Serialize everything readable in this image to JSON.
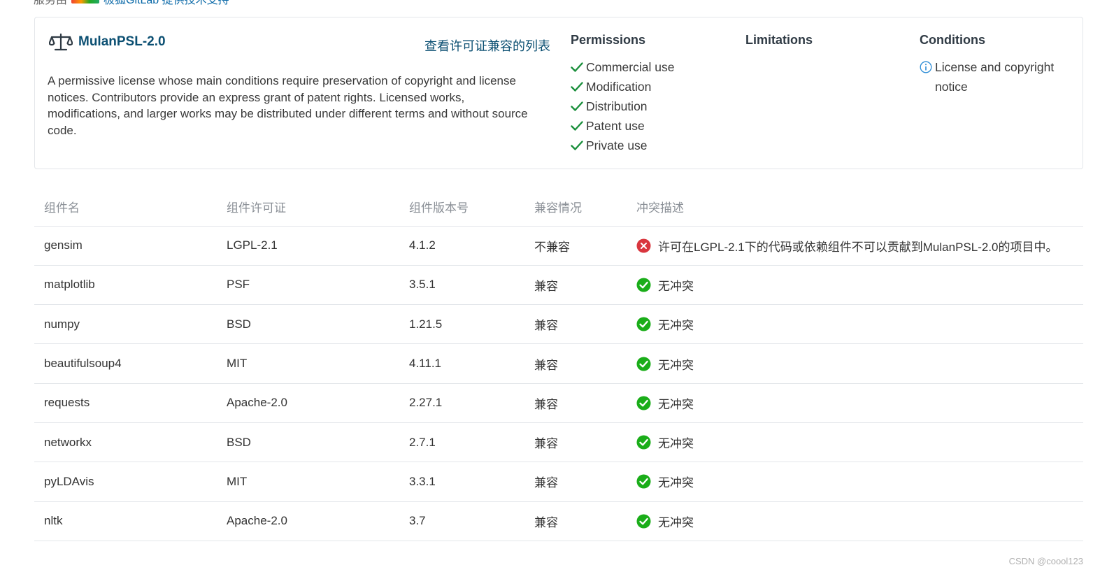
{
  "top_partial": {
    "text_left": "服务由",
    "link": "极狐GitLab 提供技术支持"
  },
  "license": {
    "name": "MulanPSL-2.0",
    "compat_link": "查看许可证兼容的列表",
    "description": "A permissive license whose main conditions require preservation of copyright and license notices. Contributors provide an express grant of patent rights. Licensed works, modifications, and larger works may be distributed under different terms and without source code.",
    "permissions": {
      "title": "Permissions",
      "items": [
        "Commercial use",
        "Modification",
        "Distribution",
        "Patent use",
        "Private use"
      ]
    },
    "limitations": {
      "title": "Limitations",
      "items": []
    },
    "conditions": {
      "title": "Conditions",
      "items": [
        "License and copyright notice"
      ]
    }
  },
  "table": {
    "headers": [
      "组件名",
      "组件许可证",
      "组件版本号",
      "兼容情况",
      "冲突描述"
    ],
    "rows": [
      {
        "name": "gensim",
        "license": "LGPL-2.1",
        "version": "4.1.2",
        "compat": "不兼容",
        "status": "error",
        "desc": "许可在LGPL-2.1下的代码或依赖组件不可以贡献到MulanPSL-2.0的项目中。"
      },
      {
        "name": "matplotlib",
        "license": "PSF",
        "version": "3.5.1",
        "compat": "兼容",
        "status": "ok",
        "desc": "无冲突"
      },
      {
        "name": "numpy",
        "license": "BSD",
        "version": "1.21.5",
        "compat": "兼容",
        "status": "ok",
        "desc": "无冲突"
      },
      {
        "name": "beautifulsoup4",
        "license": "MIT",
        "version": "4.11.1",
        "compat": "兼容",
        "status": "ok",
        "desc": "无冲突"
      },
      {
        "name": "requests",
        "license": "Apache-2.0",
        "version": "2.27.1",
        "compat": "兼容",
        "status": "ok",
        "desc": "无冲突"
      },
      {
        "name": "networkx",
        "license": "BSD",
        "version": "2.7.1",
        "compat": "兼容",
        "status": "ok",
        "desc": "无冲突"
      },
      {
        "name": "pyLDAvis",
        "license": "MIT",
        "version": "3.3.1",
        "compat": "兼容",
        "status": "ok",
        "desc": "无冲突"
      },
      {
        "name": "nltk",
        "license": "Apache-2.0",
        "version": "3.7",
        "compat": "兼容",
        "status": "ok",
        "desc": "无冲突"
      }
    ]
  },
  "watermark": "CSDN @coool123",
  "colors": {
    "link": "#0b4f72",
    "check": "#1a8f3c",
    "ok_icon": "#1aad19",
    "error_icon": "#d9363e",
    "info_icon": "#2a8bd6"
  },
  "icons": {
    "license": "scale-icon",
    "permission": "check-icon",
    "condition": "info-icon",
    "ok": "check-circle-icon",
    "error": "close-circle-icon"
  }
}
